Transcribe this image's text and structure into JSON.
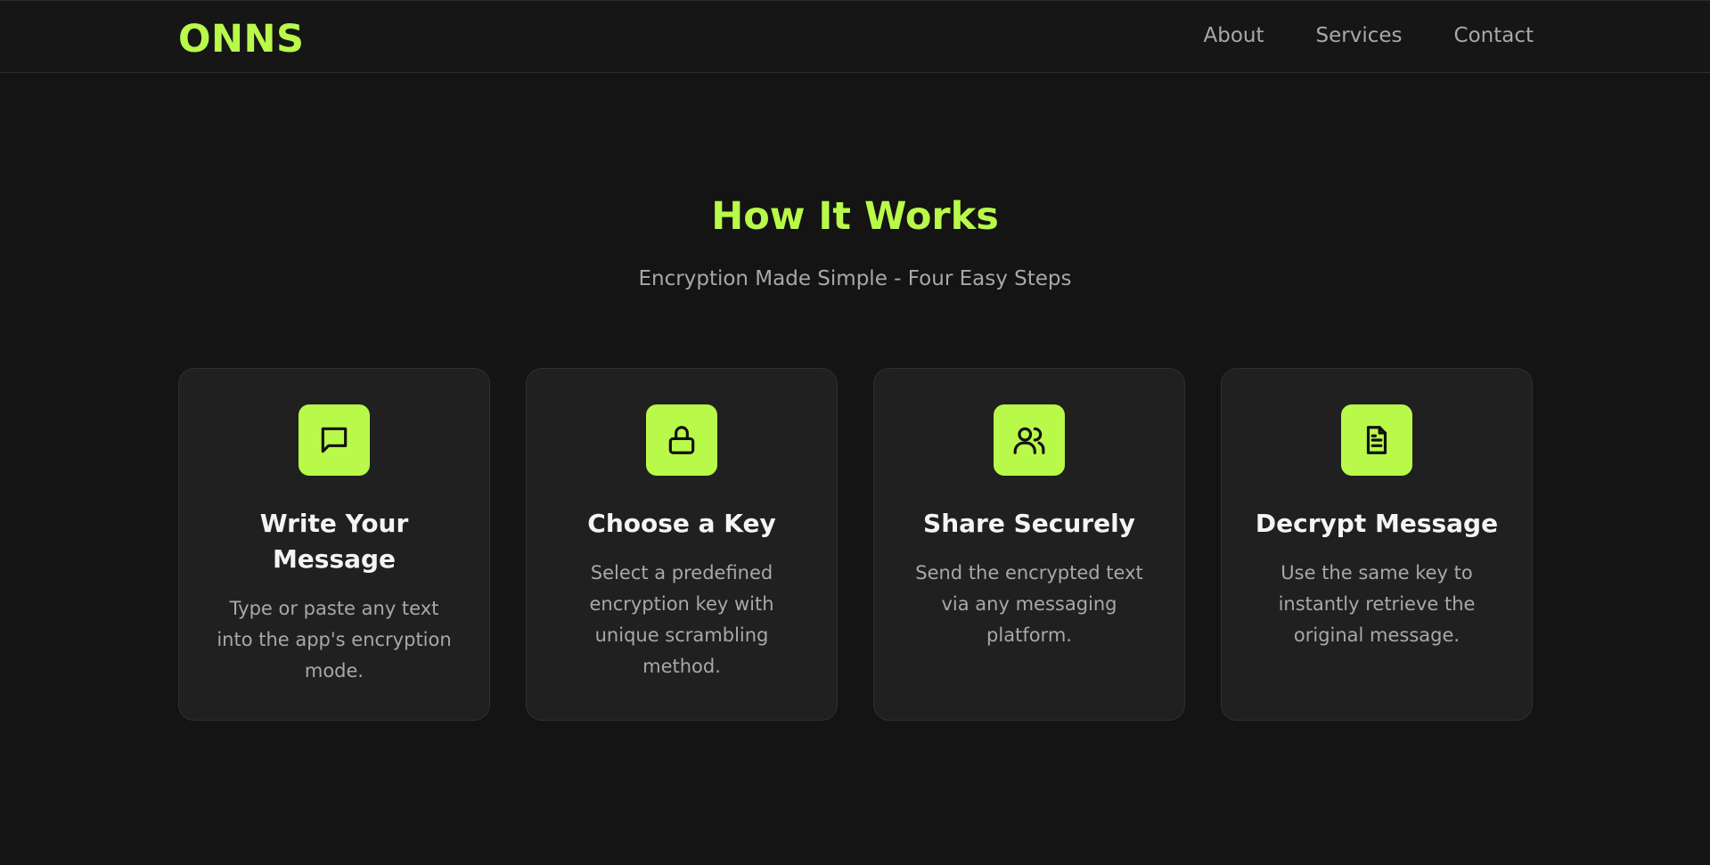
{
  "brand": {
    "logo": "ONNS",
    "accent_color": "#b8f94a"
  },
  "nav": {
    "items": [
      {
        "label": "About"
      },
      {
        "label": "Services"
      },
      {
        "label": "Contact"
      }
    ]
  },
  "hero": {
    "title": "How It Works",
    "subtitle": "Encryption Made Simple - Four Easy Steps"
  },
  "steps": [
    {
      "icon": "message-icon",
      "title": "Write Your Message",
      "description": "Type or paste any text into the app's encryption mode."
    },
    {
      "icon": "lock-icon",
      "title": "Choose a Key",
      "description": "Select a predefined encryption key with unique scrambling method."
    },
    {
      "icon": "users-icon",
      "title": "Share Securely",
      "description": "Send the encrypted text via any messaging platform."
    },
    {
      "icon": "document-icon",
      "title": "Decrypt Message",
      "description": "Use the same key to instantly retrieve the original message."
    }
  ]
}
